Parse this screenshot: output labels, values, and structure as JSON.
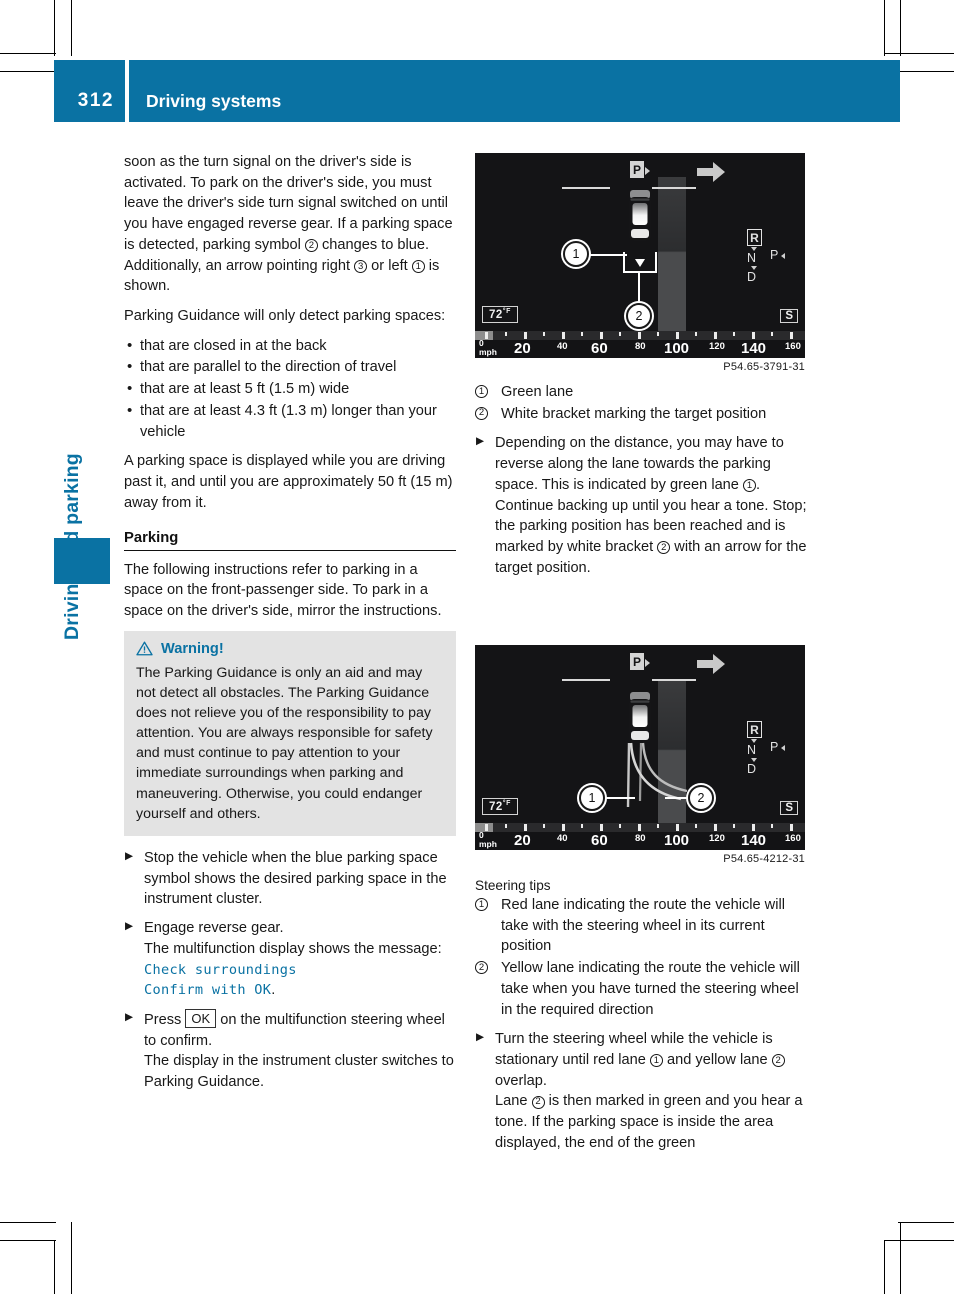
{
  "page": {
    "number": "312",
    "header_title": "Driving systems",
    "side_tab_label": "Driving and parking",
    "accent_color": "#0a72a3"
  },
  "left_column": {
    "para1": "soon as the turn signal on the driver's side is activated. To park on the driver's side, you must leave the driver's side turn signal switched on until you have engaged reverse gear. If a parking space is detected, parking symbol @2 changes to blue. Additionally, an arrow pointing right @3 or left @1 is shown.",
    "para1_parts": {
      "a": "soon as the turn signal on the driver's side is activated. To park on the driver's side, you must leave the driver's side turn signal switched on until you have engaged reverse gear. If a parking space is detected, parking symbol ",
      "n1": "2",
      "b": " changes to blue. Additionally, an arrow pointing right ",
      "n2": "3",
      "c": " or left ",
      "n3": "1",
      "d": " is shown."
    },
    "para2": "Parking Guidance will only detect parking spaces:",
    "bullets": [
      "that are closed in at the back",
      "that are parallel to the direction of travel",
      "that are at least 5 ft (1.5 m) wide",
      "that are at least 4.3 ft (1.3 m) longer than your vehicle"
    ],
    "para3": "A parking space is displayed while you are driving past it, and until you are approximately 50 ft (15 m) away from it.",
    "heading_parking": "Parking",
    "para4": "The following instructions refer to parking in a space on the front-passenger side. To park in a space on the driver's side, mirror the instructions.",
    "warning": {
      "title": "Warning!",
      "body": "The Parking Guidance is only an aid and may not detect all obstacles. The Parking Guidance does not relieve you of the responsibility to pay attention. You are always responsible for safety and must continue to pay attention to your immediate surroundings when parking and maneuvering. Otherwise, you could endanger yourself and others."
    },
    "steps": {
      "step1": "Stop the vehicle when the blue parking space symbol shows the desired parking space in the instrument cluster.",
      "step2_a": "Engage reverse gear.",
      "step2_b": "The multifunction display shows the message: ",
      "step2_msg_line1": "Check surroundings",
      "step2_msg_line2": "Confirm with OK",
      "step2_end": ".",
      "step3_a": "Press ",
      "step3_key": "OK",
      "step3_b": " on the multifunction steering wheel to confirm.",
      "step3_c": "The display in the instrument cluster switches to Parking Guidance."
    }
  },
  "right_column": {
    "figure1": {
      "caption": "P54.65-3791-31",
      "temperature": "72",
      "temperature_unit": "°F",
      "gear_positions": [
        "R",
        "N",
        "P",
        "D"
      ],
      "selected_gear": "R",
      "transmission_mode": "S",
      "parking_sign": "P",
      "speed_unit": "mph",
      "speed_ticks": [
        "0",
        "20",
        "40",
        "60",
        "80",
        "100",
        "120",
        "140",
        "160"
      ],
      "callouts": [
        "1",
        "2"
      ]
    },
    "figure2": {
      "caption": "P54.65-4212-31",
      "temperature": "72",
      "temperature_unit": "°F",
      "gear_positions": [
        "R",
        "N",
        "P",
        "D"
      ],
      "selected_gear": "R",
      "transmission_mode": "S",
      "parking_sign": "P",
      "speed_unit": "mph",
      "speed_ticks": [
        "0",
        "20",
        "40",
        "60",
        "80",
        "100",
        "120",
        "140",
        "160"
      ],
      "callouts": [
        "1",
        "2"
      ]
    },
    "legend1": [
      {
        "num": "1",
        "text": "Green lane"
      },
      {
        "num": "2",
        "text": "White bracket marking the target position"
      }
    ],
    "step_after_fig1": {
      "a": "Depending on the distance, you may have to reverse along the lane towards the parking space. This is indicated by green lane ",
      "n1": "1",
      "b": ".",
      "c": "Continue backing up until you hear a tone. Stop; the parking position has been reached and is marked by white bracket ",
      "n2": "2",
      "d": " with an arrow for the target position."
    },
    "steering_tips_label": "Steering tips",
    "legend2": [
      {
        "num": "1",
        "text": "Red lane indicating the route the vehicle will take with the steering wheel in its current position"
      },
      {
        "num": "2",
        "text": "Yellow lane indicating the route the vehicle will take when you have turned the steering wheel in the required direction"
      }
    ],
    "step_after_fig2": {
      "a": "Turn the steering wheel while the vehicle is stationary until red lane ",
      "n1": "1",
      "b": " and yellow lane ",
      "n2": "2",
      "c": " overlap.",
      "d": "Lane ",
      "n3": "2",
      "e": " is then marked in green and you hear a tone. If the parking space is inside the area displayed, the end of the green"
    }
  }
}
